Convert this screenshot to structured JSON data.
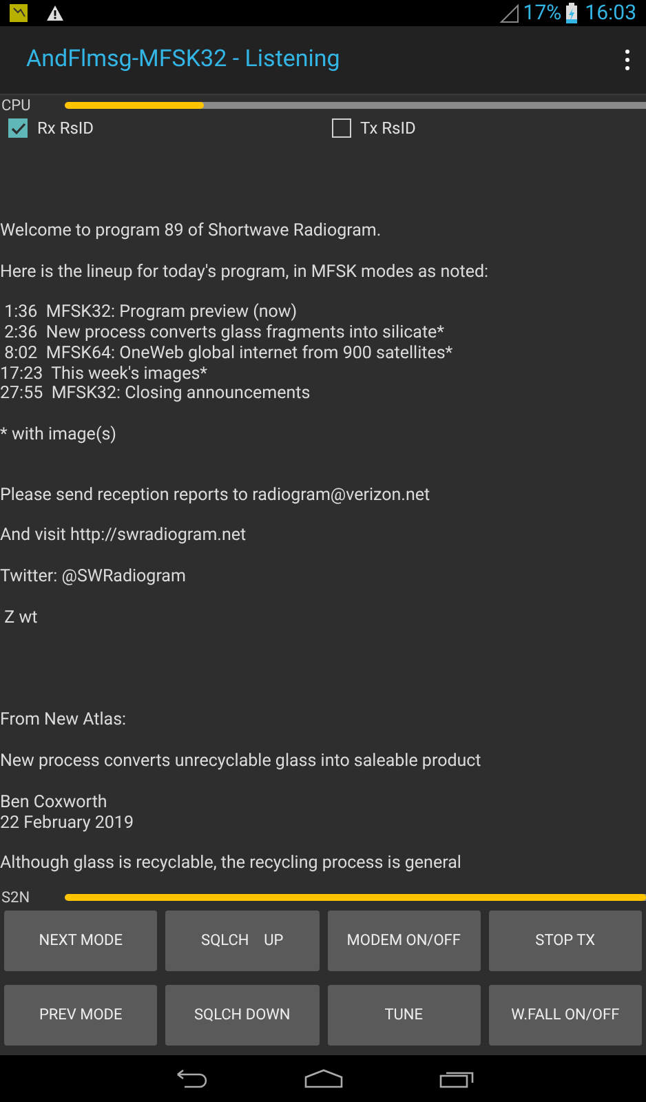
{
  "status_bar": {
    "battery": "17%",
    "time": "16:03"
  },
  "action_bar": {
    "title": "AndFlmsg-MFSK32 - Listening"
  },
  "cpu_meter": {
    "label": "CPU",
    "level": 0.24
  },
  "checkboxes": [
    {
      "label": "Rx RsID",
      "checked": true
    },
    {
      "label": "Tx RsID",
      "checked": false
    }
  ],
  "message": [
    {
      "lines": [
        "Welcome to program 89 of Shortwave Radiogram."
      ]
    },
    {
      "lines": [
        "Here is the lineup for today's program, in MFSK modes as noted:"
      ]
    },
    {
      "lines": [
        " 1:36  MFSK32: Program preview (now)",
        " 2:36  New process converts glass fragments into silicate*",
        " 8:02  MFSK64: OneWeb global internet from 900 satellites*",
        "17:23  This week's images*",
        "27:55  MFSK32: Closing announcements"
      ]
    },
    {
      "lines": [
        "* with image(s)"
      ]
    },
    {
      "lines": [
        "Please send reception reports to radiogram@verizon.net"
      ]
    },
    {
      "lines": [
        "And visit http://swradiogram.net"
      ]
    },
    {
      "lines": [
        "Twitter: @SWRadiogram"
      ]
    },
    {
      "lines": [
        " Z wt"
      ]
    },
    {
      "lines": [
        "From New Atlas:"
      ]
    },
    {
      "lines": [
        "New process converts unrecyclable glass into saleable product"
      ]
    },
    {
      "lines": [
        "Ben Coxworth",
        "22 February 2019"
      ]
    },
    {
      "lines": [
        "Although glass is recyclable, the recycling process is general"
      ]
    }
  ],
  "s2n_meter": {
    "label": "S2N",
    "level": 1
  },
  "buttons": [
    "NEXT MODE",
    "SQLCH    UP",
    "MODEM ON/OFF",
    "STOP TX",
    "PREV MODE",
    "SQLCH DOWN",
    "TUNE",
    "W.FALL ON/OFF"
  ]
}
